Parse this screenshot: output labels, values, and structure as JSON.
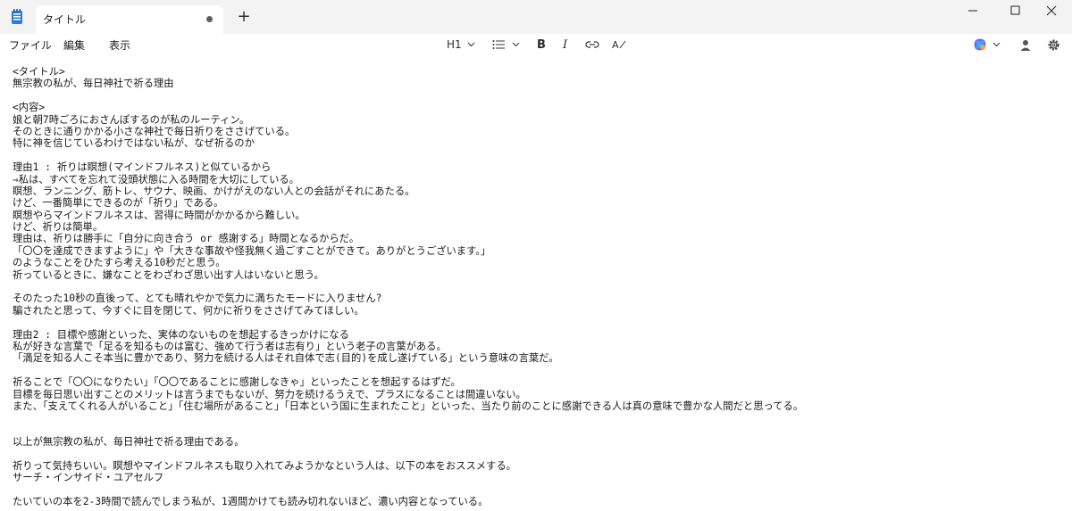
{
  "tab": {
    "title": "タイトル",
    "new_tab_label": "+"
  },
  "menu": {
    "file": "ファイル",
    "edit": "編集",
    "view": "表示"
  },
  "toolbar": {
    "heading": "H1",
    "bold": "B",
    "italic": "I",
    "clear_format": "A"
  },
  "colors": {
    "accent": "#0067c0",
    "tabbar_bg": "#f3f3f3"
  },
  "document": {
    "lines": [
      "<タイトル>",
      "無宗教の私が、毎日神社で祈る理由",
      "",
      "<内容>",
      "娘と朝7時ごろにおさんぽするのが私のルーティン。",
      "そのときに通りかかる小さな神社で毎日祈りをささげている。",
      "特に神を信じているわけではない私が、なぜ祈るのか",
      "",
      "理由1 : 祈りは瞑想(マインドフルネス)と似ているから",
      "⇒私は、すべてを忘れて没頭状態に入る時間を大切にしている。",
      "瞑想、ランニング、筋トレ、サウナ、映画、かけがえのない人との会話がそれにあたる。",
      "けど、一番簡単にできるのが「祈り」である。",
      "瞑想やらマインドフルネスは、習得に時間がかかるから難しい。",
      "けど、祈りは簡単。",
      "理由は、祈りは勝手に「自分に向き合う or 感謝する」時間となるからだ。",
      "「〇〇を達成できますように」や「大きな事故や怪我無く過ごすことができて。ありがとうございます。」",
      "のようなことをひたすら考える10秒だと思う。",
      "祈っているときに、嫌なことをわざわざ思い出す人はいないと思う。",
      "",
      "そのたった10秒の直後って、とても晴れやかで気力に満ちたモードに入りません?",
      "騙されたと思って、今すぐに目を閉じて、何かに祈りをささげてみてほしい。",
      "",
      "理由2 : 目標や感謝といった、実体のないものを想起するきっかけになる",
      "私が好きな言葉で「足るを知るものは富む、強めて行う者は志有り」という老子の言葉がある。",
      "「満足を知る人こそ本当に豊かであり、努力を続ける人はそれ自体で志(目的)を成し遂げている」という意味の言葉だ。",
      "",
      "祈ることで「〇〇になりたい」「〇〇であることに感謝しなきゃ」といったことを想起するはずだ。",
      "目標を毎日思い出すことのメリットは言うまでもないが、努力を続けるうえで、プラスになることは間違いない。",
      "また、「支えてくれる人がいること」「住む場所があること」「日本という国に生まれたこと」といった、当たり前のことに感謝できる人は真の意味で豊かな人間だと思ってる。",
      "",
      "",
      "以上が無宗教の私が、毎日神社で祈る理由である。",
      "",
      "祈りって気持ちいい。瞑想やマインドフルネスも取り入れてみようかなという人は、以下の本をおススメする。",
      "サーチ・インサイド・ユアセルフ",
      "",
      "たいていの本を2-3時間で読んでしまう私が、1週間かけても読み切れないほど、濃い内容となっている。"
    ]
  }
}
